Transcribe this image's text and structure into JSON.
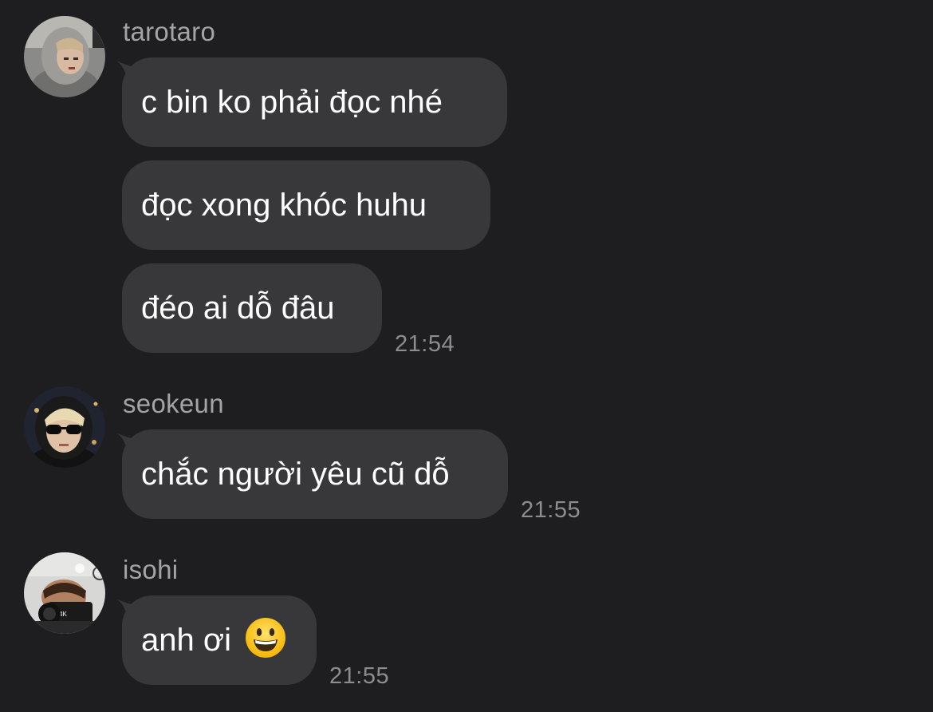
{
  "conversation": {
    "groups": [
      {
        "sender": "tarotaro",
        "avatar": "avatar-tarotaro",
        "messages": [
          "c bin ko phải đọc nhé",
          "đọc xong khóc huhu",
          "đéo ai dỗ đâu"
        ],
        "time": "21:54"
      },
      {
        "sender": "seokeun",
        "avatar": "avatar-seokeun",
        "messages": [
          "chắc người yêu cũ dỗ"
        ],
        "time": "21:55"
      },
      {
        "sender": "isohi",
        "avatar": "avatar-isohi",
        "messages": [
          "anh ơi"
        ],
        "emoji": "grinning-face-emoji",
        "time": "21:55"
      }
    ]
  },
  "colors": {
    "background": "#1e1e20",
    "bubble": "#38383b",
    "sender_name": "#a4a4a8",
    "timestamp": "#8d8d91",
    "message_text": "#ffffff"
  }
}
